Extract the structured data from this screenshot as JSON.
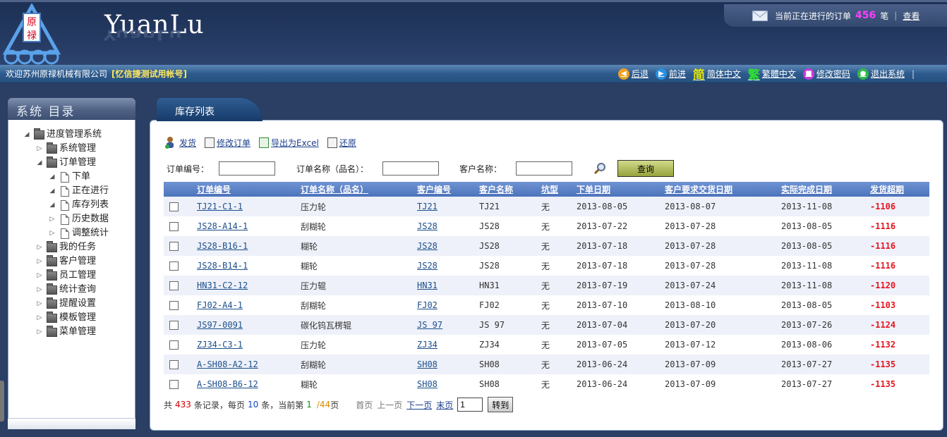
{
  "header": {
    "logo_text": "原禄",
    "brand": "YuanLu",
    "orders": {
      "prefix": "当前正在进行的订单",
      "count": "456",
      "unit": "笔",
      "sep": "|",
      "view_link": "查看"
    }
  },
  "topbar": {
    "welcome": "欢迎苏州原禄机械有限公司",
    "account": "[忆信捷测试用帐号]",
    "buttons": [
      {
        "label": "后退",
        "icon": "back-arrow-icon",
        "color": "#f0a020"
      },
      {
        "label": "前进",
        "icon": "forward-arrow-icon",
        "color": "#2a8fe0"
      },
      {
        "label": "简体中文",
        "icon": "simplified-chinese-icon",
        "glyph": "简",
        "color": "#e6e600"
      },
      {
        "label": "繁體中文",
        "icon": "traditional-chinese-icon",
        "glyph": "繁",
        "color": "#2ee02e"
      },
      {
        "label": "修改密码",
        "icon": "lock-icon",
        "color": "#c83ad8"
      },
      {
        "label": "退出系统",
        "icon": "exit-icon",
        "color": "#2fb84a"
      }
    ]
  },
  "sidebar": {
    "title": "系统 目录",
    "tree": [
      {
        "label": "进度管理系统",
        "level": 0,
        "type": "folder",
        "toggle": "◢"
      },
      {
        "label": "系统管理",
        "level": 1,
        "type": "folder",
        "toggle": "▷"
      },
      {
        "label": "订单管理",
        "level": 1,
        "type": "folder",
        "toggle": "◢"
      },
      {
        "label": "下单",
        "level": 2,
        "type": "doc",
        "toggle": "◢"
      },
      {
        "label": "正在进行",
        "level": 2,
        "type": "doc",
        "toggle": "◢"
      },
      {
        "label": "库存列表",
        "level": 2,
        "type": "doc",
        "toggle": "◢"
      },
      {
        "label": "历史数据",
        "level": 2,
        "type": "doc",
        "toggle": "▷"
      },
      {
        "label": "调整统计",
        "level": 2,
        "type": "doc",
        "toggle": "▷"
      },
      {
        "label": "我的任务",
        "level": 1,
        "type": "folder",
        "toggle": "▷"
      },
      {
        "label": "客户管理",
        "level": 1,
        "type": "folder",
        "toggle": "▷"
      },
      {
        "label": "员工管理",
        "level": 1,
        "type": "folder",
        "toggle": "▷"
      },
      {
        "label": "统计查询",
        "level": 1,
        "type": "folder",
        "toggle": "▷"
      },
      {
        "label": "提醒设置",
        "level": 1,
        "type": "folder",
        "toggle": "▷"
      },
      {
        "label": "模板管理",
        "level": 1,
        "type": "folder",
        "toggle": "▷"
      },
      {
        "label": "菜单管理",
        "level": 1,
        "type": "folder",
        "toggle": "▷"
      }
    ]
  },
  "tab": {
    "label": "库存列表"
  },
  "actions": [
    {
      "label": "发货",
      "icon": "ship-user-icon"
    },
    {
      "label": "修改订单",
      "icon": "edit-order-icon"
    },
    {
      "label": "导出为Excel",
      "icon": "excel-icon"
    },
    {
      "label": "还原",
      "icon": "restore-icon"
    }
  ],
  "search": {
    "order_no_label": "订单编号：",
    "order_name_label": "订单名称（品名）：",
    "customer_name_label": "客户名称：",
    "order_no_value": "",
    "order_name_value": "",
    "customer_name_value": "",
    "button": "查询"
  },
  "table": {
    "columns": [
      "订单编号",
      "订单名称（品名）",
      "客户编号",
      "客户名称",
      "坑型",
      "下单日期",
      "客户要求交货日期",
      "实际完成日期",
      "发货超期"
    ],
    "rows": [
      [
        "TJ21-C1-1",
        "压力轮",
        "TJ21",
        "TJ21",
        "无",
        "2013-08-05",
        "2013-08-07",
        "2013-11-08",
        "-1106"
      ],
      [
        "JS28-A14-1",
        "刮糊轮",
        "JS28",
        "JS28",
        "无",
        "2013-07-22",
        "2013-07-28",
        "2013-08-05",
        "-1116"
      ],
      [
        "JS28-B16-1",
        "糊轮",
        "JS28",
        "JS28",
        "无",
        "2013-07-18",
        "2013-07-28",
        "2013-08-05",
        "-1116"
      ],
      [
        "JS28-B14-1",
        "糊轮",
        "JS28",
        "JS28",
        "无",
        "2013-07-18",
        "2013-07-28",
        "2013-11-08",
        "-1116"
      ],
      [
        "HN31-C2-12",
        "压力辊",
        "HN31",
        "HN31",
        "无",
        "2013-07-19",
        "2013-07-24",
        "2013-11-08",
        "-1120"
      ],
      [
        "FJ02-A4-1",
        "刮糊轮",
        "FJ02",
        "FJ02",
        "无",
        "2013-07-10",
        "2013-08-10",
        "2013-08-05",
        "-1103"
      ],
      [
        "JS97-0091",
        "碳化钨瓦楞辊",
        "JS 97",
        "JS 97",
        "无",
        "2013-07-04",
        "2013-07-20",
        "2013-07-26",
        "-1124"
      ],
      [
        "ZJ34-C3-1",
        "压力轮",
        "ZJ34",
        "ZJ34",
        "无",
        "2013-07-05",
        "2013-07-12",
        "2013-08-06",
        "-1132"
      ],
      [
        "A-SH08-A2-12",
        "刮糊轮",
        "SH08",
        "SH08",
        "无",
        "2013-06-24",
        "2013-07-09",
        "2013-07-27",
        "-1135"
      ],
      [
        "A-SH08-B6-12",
        "糊轮",
        "SH08",
        "SH08",
        "无",
        "2013-06-24",
        "2013-07-09",
        "2013-07-27",
        "-1135"
      ]
    ]
  },
  "pager": {
    "p1": "共",
    "total": "433",
    "p2": "条记录，每页",
    "per_page": "10",
    "p3": "条，当前第",
    "current": "1",
    "pages": "/44",
    "p4": "页",
    "first": "首页",
    "prev": "上一页",
    "next": "下一页",
    "last": "末页",
    "page_input": "1",
    "goto": "转到"
  }
}
